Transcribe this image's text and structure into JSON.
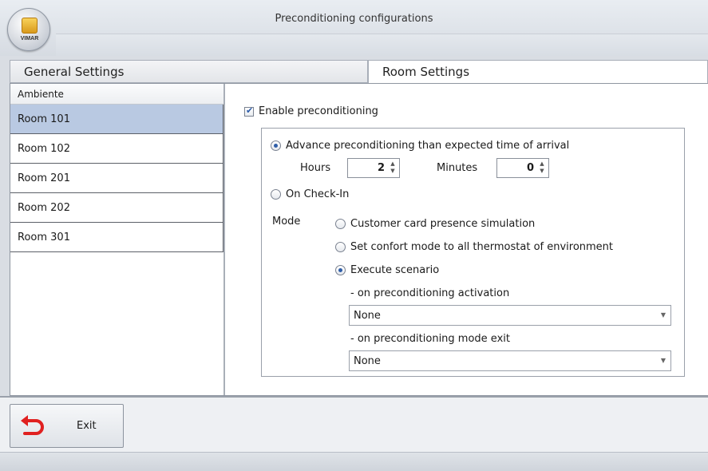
{
  "window": {
    "title": "Preconditioning configurations",
    "logo_text": "VIMAR"
  },
  "tabs": [
    {
      "label": "General Settings",
      "active": false
    },
    {
      "label": "Room Settings",
      "active": true
    }
  ],
  "rooms": {
    "header": "Ambiente",
    "items": [
      "Room 101",
      "Room 102",
      "Room 201",
      "Room 202",
      "Room 301"
    ],
    "selected": "Room 101"
  },
  "settings": {
    "enable_label": "Enable preconditioning",
    "enable_checked": true,
    "advance_label": "Advance preconditioning than expected time of arrival",
    "advance_selected": true,
    "hours_label": "Hours",
    "hours_value": "2",
    "minutes_label": "Minutes",
    "minutes_value": "0",
    "checkin_label": "On Check-In",
    "checkin_selected": false,
    "mode_label": "Mode",
    "mode_options": [
      {
        "label": "Customer card presence simulation",
        "selected": false
      },
      {
        "label": "Set confort mode to all thermostat of environment",
        "selected": false
      },
      {
        "label": "Execute scenario",
        "selected": true
      }
    ],
    "activation_label": "- on preconditioning activation",
    "activation_value": "None",
    "exit_mode_label": "- on preconditioning mode exit",
    "exit_mode_value": "None"
  },
  "footer": {
    "exit_label": "Exit",
    "exit_icon": "back-arrow-icon",
    "exit_icon_color": "#e02020"
  }
}
